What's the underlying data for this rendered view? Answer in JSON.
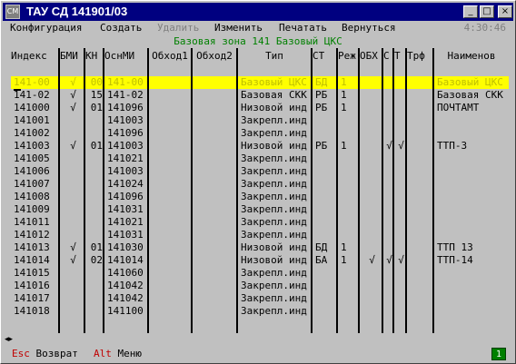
{
  "window": {
    "title": "ТАУ СД 141901/03",
    "app_icon": "terminal-icon",
    "app_icon_text": "CM",
    "buttons": [
      "minimize",
      "maximize",
      "close"
    ]
  },
  "menu": {
    "items": [
      {
        "label": "Конфигурация",
        "disabled": false
      },
      {
        "label": "Создать",
        "disabled": false
      },
      {
        "label": "Удалить",
        "disabled": true
      },
      {
        "label": "Изменить",
        "disabled": false
      },
      {
        "label": "Печатать",
        "disabled": false
      },
      {
        "label": "Вернуться",
        "disabled": false
      }
    ],
    "clock": "4:30:46"
  },
  "zone_title": "Базовая зона 141 Базовый ЦКС",
  "table": {
    "columns": [
      "Индекс",
      "БМИ",
      "КН",
      "ОснМИ",
      "Обход1",
      "Обход2",
      "Тип",
      "СТ",
      "Реж",
      "ОБХ",
      "С",
      "Т",
      "Трф",
      "Наименов"
    ],
    "rows": [
      {
        "selected": true,
        "cells": [
          "141-00",
          "√",
          "00",
          "141-00",
          "",
          "",
          "Базовый ЦКС",
          "БД",
          "1",
          "",
          "",
          "",
          "",
          "Базовый ЦКС"
        ]
      },
      {
        "selected": false,
        "cells": [
          "141-02",
          "√",
          "15",
          "141-02",
          "",
          "",
          "Базовая СКК",
          "РБ",
          "1",
          "",
          "",
          "",
          "",
          "Базовая СКК"
        ]
      },
      {
        "selected": false,
        "cells": [
          "141000",
          "√",
          "01",
          "141096",
          "",
          "",
          "Низовой инд",
          "РБ",
          "1",
          "",
          "",
          "",
          "",
          "ПОЧТАМТ"
        ]
      },
      {
        "selected": false,
        "cells": [
          "141001",
          "",
          "",
          "141003",
          "",
          "",
          "Закрепл.инд",
          "",
          "",
          "",
          "",
          "",
          "",
          ""
        ]
      },
      {
        "selected": false,
        "cells": [
          "141002",
          "",
          "",
          "141096",
          "",
          "",
          "Закрепл.инд",
          "",
          "",
          "",
          "",
          "",
          "",
          ""
        ]
      },
      {
        "selected": false,
        "cells": [
          "141003",
          "√",
          "01",
          "141003",
          "",
          "",
          "Низовой инд",
          "РБ",
          "1",
          "",
          "√",
          "√",
          "",
          "ТТП-3"
        ]
      },
      {
        "selected": false,
        "cells": [
          "141005",
          "",
          "",
          "141021",
          "",
          "",
          "Закрепл.инд",
          "",
          "",
          "",
          "",
          "",
          "",
          ""
        ]
      },
      {
        "selected": false,
        "cells": [
          "141006",
          "",
          "",
          "141003",
          "",
          "",
          "Закрепл.инд",
          "",
          "",
          "",
          "",
          "",
          "",
          ""
        ]
      },
      {
        "selected": false,
        "cells": [
          "141007",
          "",
          "",
          "141024",
          "",
          "",
          "Закрепл.инд",
          "",
          "",
          "",
          "",
          "",
          "",
          ""
        ]
      },
      {
        "selected": false,
        "cells": [
          "141008",
          "",
          "",
          "141096",
          "",
          "",
          "Закрепл.инд",
          "",
          "",
          "",
          "",
          "",
          "",
          ""
        ]
      },
      {
        "selected": false,
        "cells": [
          "141009",
          "",
          "",
          "141031",
          "",
          "",
          "Закрепл.инд",
          "",
          "",
          "",
          "",
          "",
          "",
          ""
        ]
      },
      {
        "selected": false,
        "cells": [
          "141011",
          "",
          "",
          "141021",
          "",
          "",
          "Закрепл.инд",
          "",
          "",
          "",
          "",
          "",
          "",
          ""
        ]
      },
      {
        "selected": false,
        "cells": [
          "141012",
          "",
          "",
          "141031",
          "",
          "",
          "Закрепл.инд",
          "",
          "",
          "",
          "",
          "",
          "",
          ""
        ]
      },
      {
        "selected": false,
        "cells": [
          "141013",
          "√",
          "01",
          "141030",
          "",
          "",
          "Низовой инд",
          "БД",
          "1",
          "",
          "",
          "",
          "",
          "ТТП 13"
        ]
      },
      {
        "selected": false,
        "cells": [
          "141014",
          "√",
          "02",
          "141014",
          "",
          "",
          "Низовой инд",
          "БА",
          "1",
          "√",
          "√",
          "√",
          "",
          "ТТП-14"
        ]
      },
      {
        "selected": false,
        "cells": [
          "141015",
          "",
          "",
          "141060",
          "",
          "",
          "Закрепл.инд",
          "",
          "",
          "",
          "",
          "",
          "",
          ""
        ]
      },
      {
        "selected": false,
        "cells": [
          "141016",
          "",
          "",
          "141042",
          "",
          "",
          "Закрепл.инд",
          "",
          "",
          "",
          "",
          "",
          "",
          ""
        ]
      },
      {
        "selected": false,
        "cells": [
          "141017",
          "",
          "",
          "141042",
          "",
          "",
          "Закрепл.инд",
          "",
          "",
          "",
          "",
          "",
          "",
          ""
        ]
      },
      {
        "selected": false,
        "cells": [
          "141018",
          "",
          "",
          "141100",
          "",
          "",
          "Закрепл.инд",
          "",
          "",
          "",
          "",
          "",
          "",
          ""
        ]
      }
    ]
  },
  "status": {
    "key1": "Esc",
    "label1": "Возврат",
    "key2": "Alt",
    "label2": "Меню",
    "page": "1"
  },
  "colors": {
    "titlebar": "#000080",
    "selection": "#ffff00",
    "zone_text": "#008000",
    "hotkey": "#c00000"
  }
}
